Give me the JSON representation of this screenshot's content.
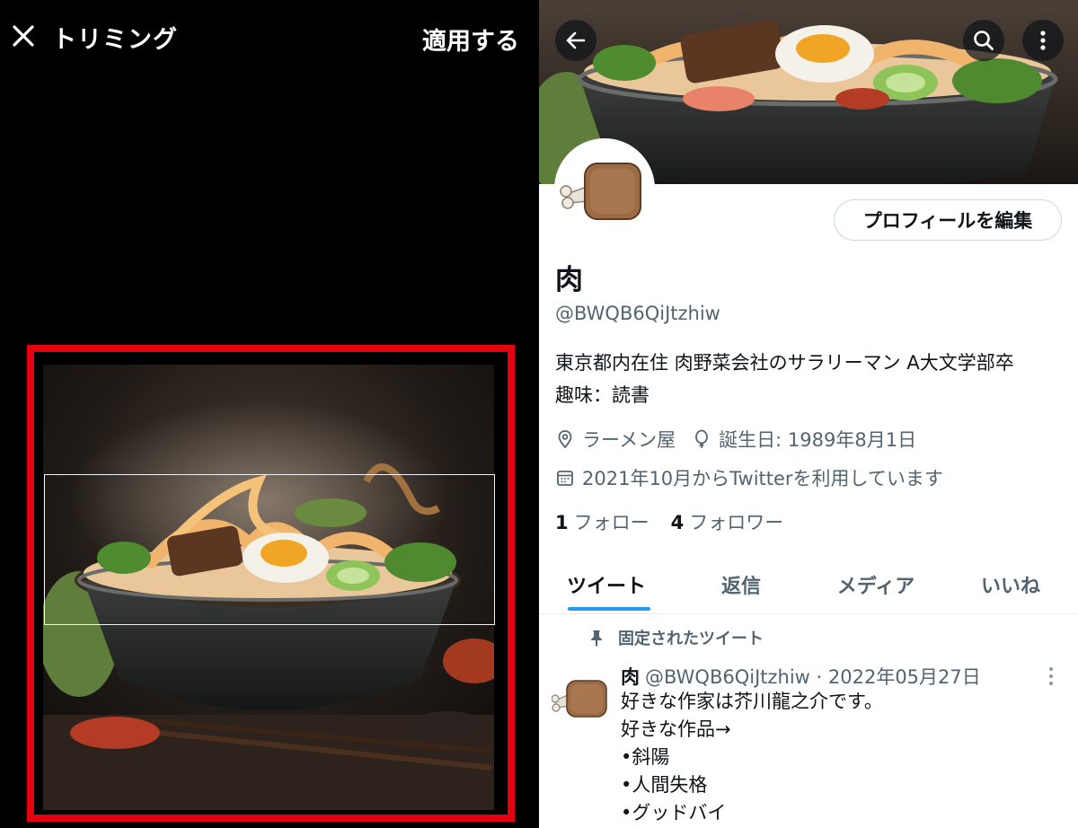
{
  "trim": {
    "title": "トリミング",
    "apply_label": "適用する"
  },
  "profile": {
    "edit_label": "プロフィールを編集",
    "display_name": "肉",
    "handle": "@BWQB6QiJtzhiw",
    "bio_line1": "東京都内在住 肉野菜会社のサラリーマン A大文学部卒",
    "bio_line2": "趣味：読書",
    "location": "ラーメン屋",
    "birthday": "誕生日: 1989年8月1日",
    "joined": "2021年10月からTwitterを利用しています",
    "following_count": "1",
    "following_label": "フォロー",
    "followers_count": "4",
    "followers_label": "フォロワー"
  },
  "tabs": [
    {
      "label": "ツイート"
    },
    {
      "label": "返信"
    },
    {
      "label": "メディア"
    },
    {
      "label": "いいね"
    }
  ],
  "pinned_label": "固定されたツイート",
  "tweet": {
    "name": "肉",
    "meta": "@BWQB6QiJtzhiw · 2022年05月27日",
    "lines": [
      "好きな作家は芥川龍之介です。",
      "好きな作品→",
      "•斜陽",
      "•人間失格",
      "•グッドバイ"
    ]
  },
  "colors": {
    "highlight_frame": "#e4000e",
    "accent": "#1d9bf0"
  },
  "icons": {
    "close": "close-icon",
    "back": "arrow-left-icon",
    "search": "search-icon",
    "more": "more-vertical-icon",
    "location": "location-pin-icon",
    "birthday": "balloon-icon",
    "calendar": "calendar-icon",
    "pin": "pin-icon"
  }
}
